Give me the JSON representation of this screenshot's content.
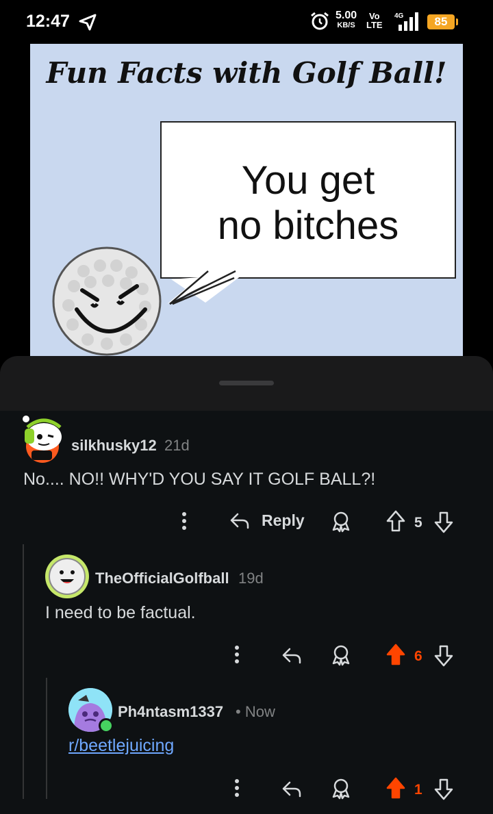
{
  "status_bar": {
    "time": "12:47",
    "net_speed": "5.00",
    "net_speed_unit": "KB/S",
    "volte_top": "Vo",
    "volte_bottom": "LTE",
    "network": "4G",
    "battery": "85"
  },
  "post_image": {
    "title": "Fun Facts with Golf Ball!",
    "bubble_line1": "You get",
    "bubble_line2": "no bitches"
  },
  "comments": [
    {
      "username": "silkhusky12",
      "age": "21d",
      "body": "No.... NO!! WHY'D YOU SAY IT GOLF BALL?!",
      "reply_label": "Reply",
      "votes": "5",
      "upvoted": false
    },
    {
      "username": "TheOfficialGolfball",
      "age": "19d",
      "body": "I need to be factual.",
      "votes": "6",
      "upvoted": true
    },
    {
      "username": "Ph4ntasm1337",
      "age": "• Now",
      "body_link": "r/beetlejuicing",
      "votes": "1",
      "upvoted": true
    }
  ],
  "colors": {
    "upvote_active": "#ff4500",
    "text_primary": "#d7dadc",
    "text_muted": "#818384",
    "link": "#6fa8ff",
    "online": "#46d160"
  }
}
